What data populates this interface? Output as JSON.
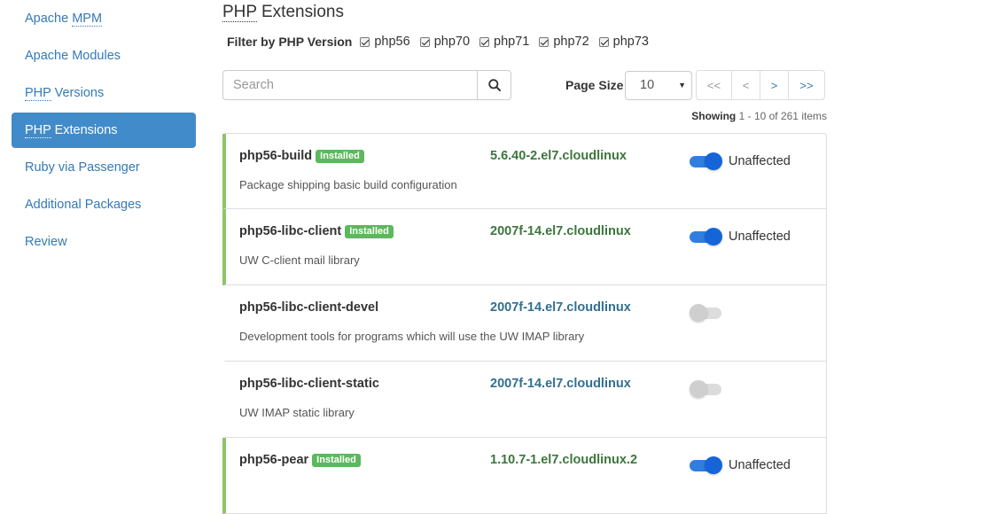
{
  "sidebar": {
    "items": [
      {
        "prefix": "Apache ",
        "abbr": "MPM",
        "suffix": ""
      },
      {
        "prefix": "Apache Modules",
        "abbr": "",
        "suffix": ""
      },
      {
        "prefix": "",
        "abbr": "PHP",
        "suffix": " Versions"
      },
      {
        "prefix": "",
        "abbr": "PHP",
        "suffix": " Extensions"
      },
      {
        "prefix": "Ruby via Passenger",
        "abbr": "",
        "suffix": ""
      },
      {
        "prefix": "Additional Packages",
        "abbr": "",
        "suffix": ""
      },
      {
        "prefix": "Review",
        "abbr": "",
        "suffix": ""
      }
    ]
  },
  "page": {
    "title_abbr": "PHP",
    "title_rest": " Extensions"
  },
  "filter": {
    "label": "Filter by PHP Version",
    "versions": [
      {
        "label": "php56",
        "checked": true
      },
      {
        "label": "php70",
        "checked": true
      },
      {
        "label": "php71",
        "checked": true
      },
      {
        "label": "php72",
        "checked": true
      },
      {
        "label": "php73",
        "checked": true
      }
    ]
  },
  "search": {
    "placeholder": "Search",
    "icon": "search-icon"
  },
  "pagination": {
    "page_size_label": "Page Size",
    "page_size_value": "10",
    "first_label": "<<",
    "prev_label": "<",
    "next_label": ">",
    "last_label": ">>"
  },
  "showing": {
    "label": "Showing",
    "range": " 1 - 10 of 261 items"
  },
  "badge_label": "Installed",
  "colors": {
    "accent": "#428bca",
    "installed_green": "#5cb85c",
    "installed_border": "#8cc668",
    "toggle_on": "#1565d8"
  },
  "packages": [
    {
      "name": "php56-build",
      "installed": true,
      "version": "5.6.40-2.el7.cloudlinux",
      "description": "Package shipping basic build configuration",
      "enabled": true,
      "status": "Unaffected"
    },
    {
      "name": "php56-libc-client",
      "installed": true,
      "version": "2007f-14.el7.cloudlinux",
      "description": "UW C-client mail library",
      "enabled": true,
      "status": "Unaffected"
    },
    {
      "name": "php56-libc-client-devel",
      "installed": false,
      "version": "2007f-14.el7.cloudlinux",
      "description": "Development tools for programs which will use the UW IMAP library",
      "enabled": false,
      "status": ""
    },
    {
      "name": "php56-libc-client-static",
      "installed": false,
      "version": "2007f-14.el7.cloudlinux",
      "description": "UW IMAP static library",
      "enabled": false,
      "status": ""
    },
    {
      "name": "php56-pear",
      "installed": true,
      "version": "1.10.7-1.el7.cloudlinux.2",
      "description": "",
      "enabled": true,
      "status": "Unaffected"
    }
  ]
}
